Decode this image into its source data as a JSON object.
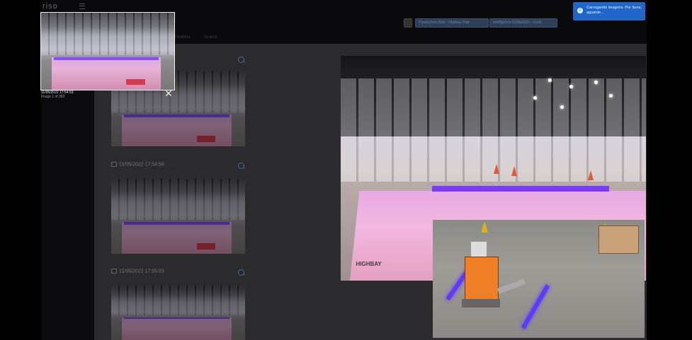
{
  "app": {
    "logo": "riso"
  },
  "toolbar": {
    "filter_primary": "Pyrotechnic Ride - Highbay Ride",
    "filter_secondary": "Intelligence 01/05/2022 - 01/06",
    "small_btn": "·"
  },
  "subtabs": [
    "Timeline",
    "Search"
  ],
  "timeline": {
    "items": [
      {
        "timestamp": "",
        "ghost": ""
      },
      {
        "timestamp": "11/05/2022 17:54:58",
        "ghost": "· · ·"
      },
      {
        "timestamp": "11/05/2022 17:55:03",
        "ghost": "· · ·"
      }
    ]
  },
  "preview": {
    "timestamp": "11/05/2022 17:54:53",
    "counter": "Image 1 of 382"
  },
  "viewer": {
    "wall_label": "HIGHBAY"
  },
  "toast": {
    "message": "Carregando imagens. Por favor, aguarde...",
    "icon": "info-icon",
    "color": "#1f66c8"
  },
  "icons": {
    "close": "close-icon",
    "zoom": "zoom-icon",
    "menu": "hamburger-icon",
    "calendar": "calendar-icon"
  }
}
